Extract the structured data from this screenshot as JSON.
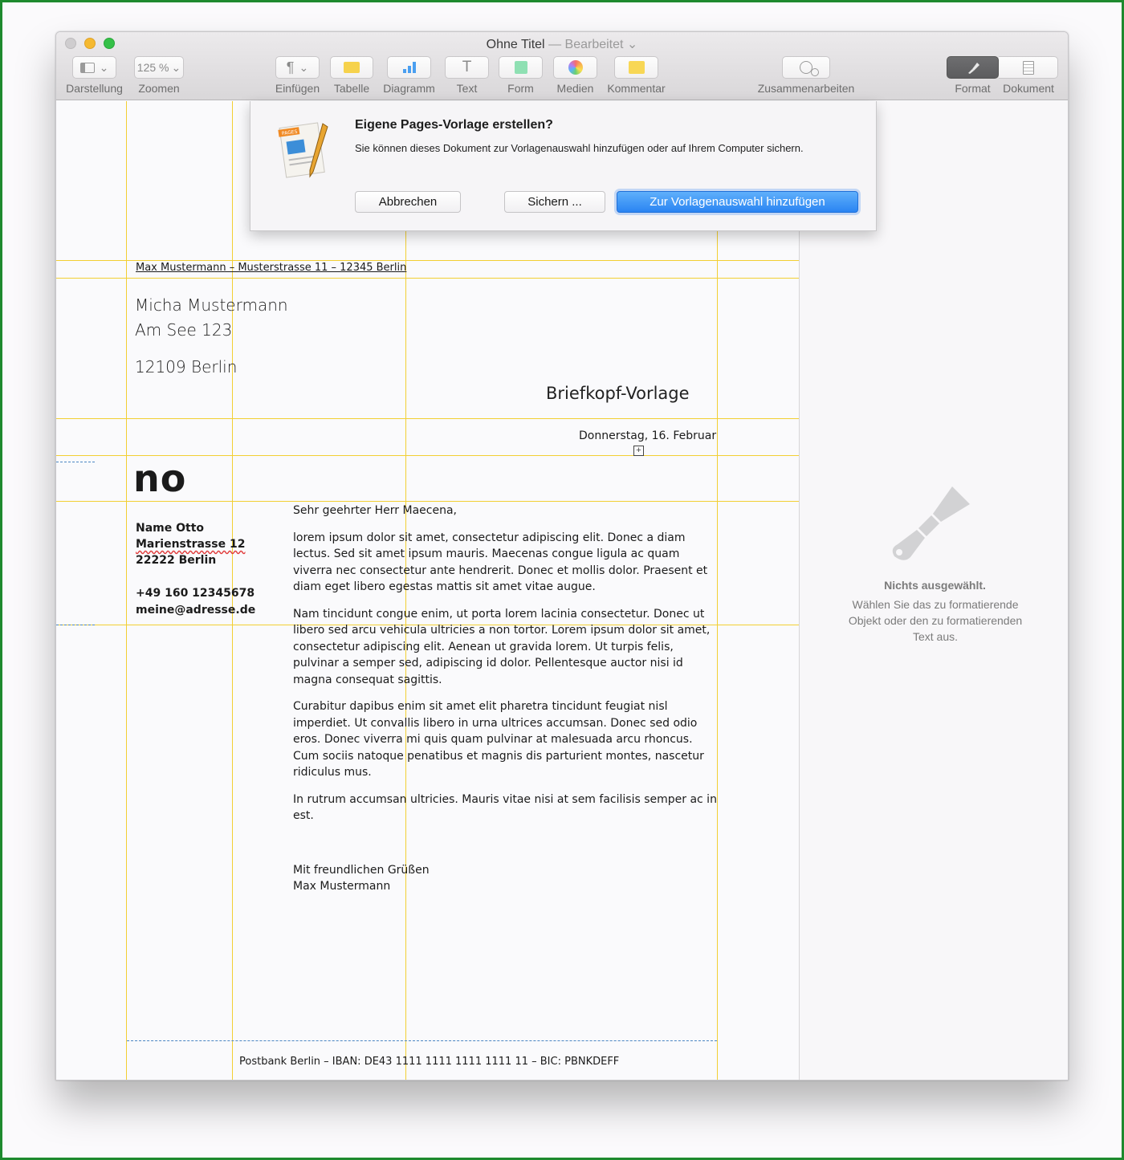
{
  "window": {
    "title": "Ohne Titel",
    "title_separator": "—",
    "title_state": "Bearbeitet",
    "title_chevron": "⌄"
  },
  "toolbar": {
    "view": {
      "label": "Darstellung",
      "icon": "sidebar-view-icon",
      "chevron": "⌄"
    },
    "zoom": {
      "label": "Zoomen",
      "value": "125 %",
      "chevron": "⌄"
    },
    "insert": {
      "label": "Einfügen",
      "glyph": "¶",
      "chevron": "⌄"
    },
    "table": {
      "label": "Tabelle",
      "icon": "table-icon"
    },
    "chart": {
      "label": "Diagramm",
      "icon": "chart-icon"
    },
    "text": {
      "label": "Text",
      "glyph": "T"
    },
    "shape": {
      "label": "Form",
      "icon": "shape-icon"
    },
    "media": {
      "label": "Medien",
      "icon": "media-icon"
    },
    "comment": {
      "label": "Kommentar",
      "icon": "comment-icon"
    },
    "collaborate": {
      "label": "Zusammenarbeiten",
      "icon": "collaborate-icon"
    },
    "format": {
      "label": "Format",
      "icon": "paintbrush-icon",
      "active": true
    },
    "document": {
      "label": "Dokument",
      "icon": "document-icon"
    }
  },
  "dialog": {
    "title": "Eigene Pages-Vorlage erstellen?",
    "message": "Sie können dieses Dokument zur Vorlagenauswahl hinzufügen oder auf Ihrem Computer sichern.",
    "cancel_label": "Abbrechen",
    "save_label": "Sichern ...",
    "add_label": "Zur Vorlagenauswahl hinzufügen",
    "icon_text": "PAGES"
  },
  "letter": {
    "sender_line": "Max Mustermann – Musterstrasse 11 – 12345 Berlin",
    "recipient_name": "Micha Mustermann",
    "recipient_street": "Am See 123",
    "recipient_city": "12109 Berlin",
    "briefkopf": "Briefkopf-Vorlage",
    "date": "Donnerstag, 16. Februar",
    "logo": "no",
    "side_name": "Name Otto",
    "side_street": "Marienstrasse 12",
    "side_city": "22222 Berlin",
    "side_phone": "+49 160 12345678",
    "side_email": "meine@adresse.de",
    "salutation": "Sehr geehrter Herr Maecena,",
    "para1": "lorem ipsum dolor sit amet, consectetur adipiscing elit. Donec a diam lectus. Sed sit amet ipsum mauris. Maecenas congue ligula ac quam viverra nec consectetur ante hendrerit. Donec et mollis dolor. Praesent et diam eget libero egestas mattis sit amet vitae augue.",
    "para2": "Nam tincidunt congue enim, ut porta lorem lacinia consectetur. Donec ut libero sed arcu vehicula ultricies a non tortor. Lorem ipsum dolor sit amet, consectetur adipiscing elit. Aenean ut gravida lorem. Ut turpis felis, pulvinar a semper sed, adipiscing id dolor. Pellentesque auctor nisi id magna consequat sagittis.",
    "para3": "Curabitur dapibus enim sit amet elit pharetra tincidunt feugiat nisl imperdiet. Ut convallis libero in urna ultrices accumsan. Donec sed odio eros. Donec viverra mi quis quam pulvinar at malesuada arcu rhoncus. Cum sociis natoque penatibus et magnis dis parturient montes, nascetur ridiculus mus.",
    "para4": "In rutrum accumsan ultricies. Mauris vitae nisi at sem facilisis semper ac in est.",
    "closing": "Mit freundlichen Grüßen",
    "signature": "Max Mustermann",
    "footer": "Postbank Berlin – IBAN: DE43 1111 1111 1111 1111 11 – BIC: PBNKDEFF",
    "anchor_glyph": "+"
  },
  "inspector": {
    "title": "Nichts ausgewählt.",
    "message": "Wählen Sie das zu formatierende Objekt oder den zu formatierenden Text aus.",
    "icon": "paintbrush-icon"
  },
  "colors": {
    "guide": "#f2cf33",
    "primary_button": "#2a84f2",
    "frame": "#1e8a2e"
  }
}
